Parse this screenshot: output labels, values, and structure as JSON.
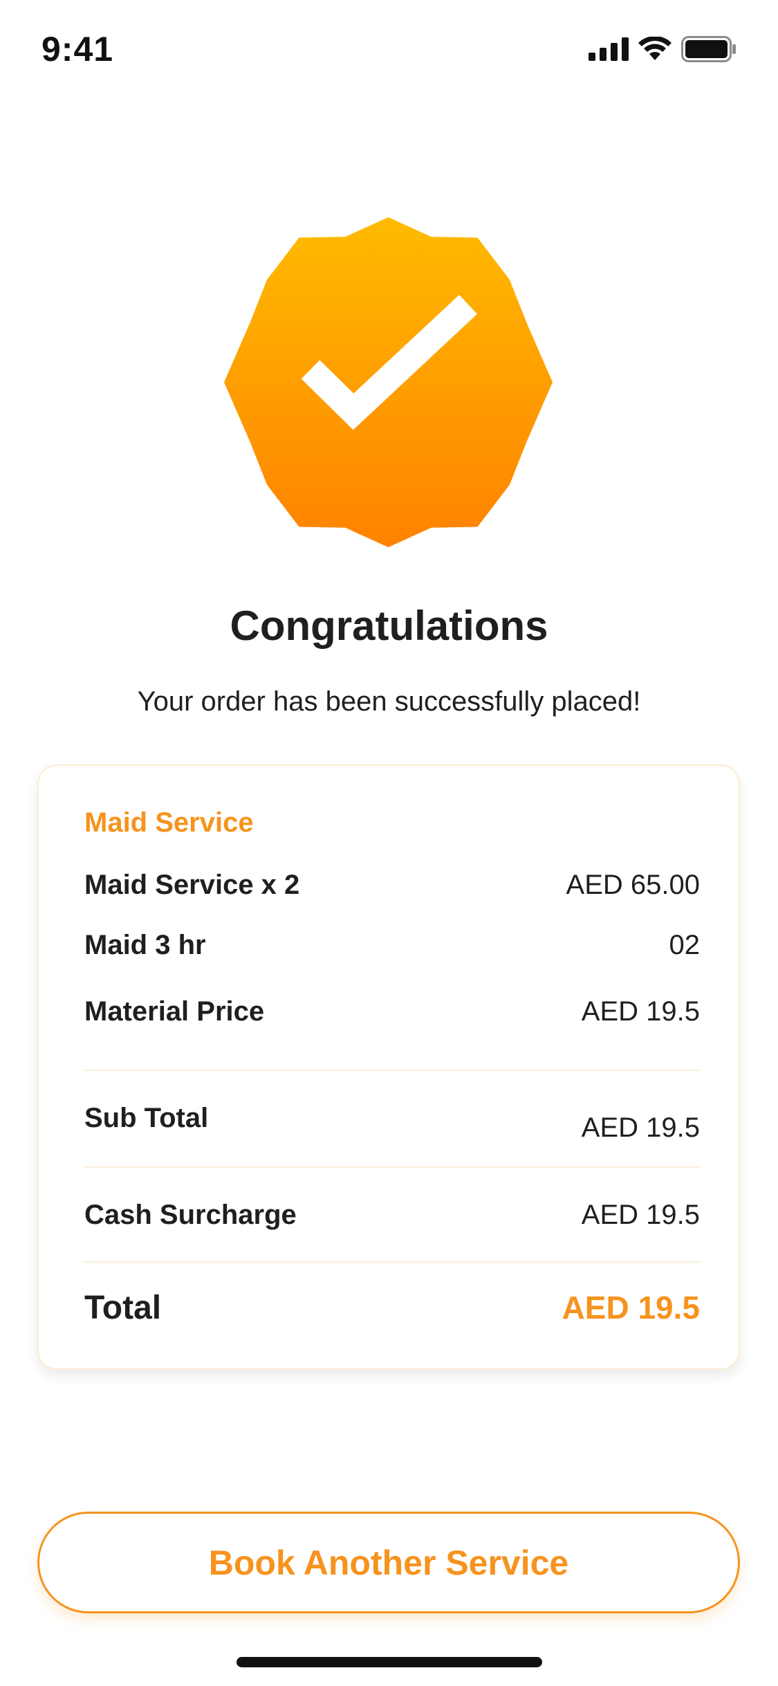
{
  "status_bar": {
    "time": "9:41",
    "icons": [
      "signal-icon",
      "wifi-icon",
      "battery-icon"
    ]
  },
  "badge": {
    "icon": "check-badge-icon",
    "colors": {
      "top": "#ffbb00",
      "bottom": "#ff8200",
      "check": "#ffffff"
    }
  },
  "title": "Congratulations",
  "subtitle": "Your order has been successfully placed!",
  "card": {
    "heading": "Maid Service",
    "items": [
      {
        "label": "Maid Service x 2",
        "value": "AED 65.00"
      },
      {
        "label": "Maid 3 hr",
        "value": "02"
      },
      {
        "label": "Material Price",
        "value": "AED 19.5"
      }
    ],
    "sub_total": {
      "label": "Sub Total",
      "value": "AED 19.5"
    },
    "cash_surcharge": {
      "label": "Cash Surcharge",
      "value": "AED 19.5"
    },
    "total": {
      "label": "Total",
      "value": "AED 19.5"
    }
  },
  "button": {
    "label": "Book Another Service"
  },
  "colors": {
    "accent": "#f6931e",
    "text": "#1f1f1f"
  }
}
